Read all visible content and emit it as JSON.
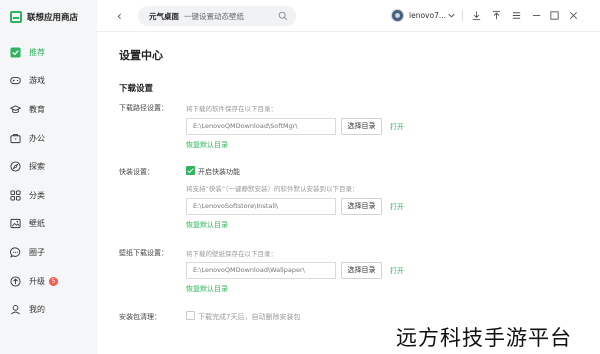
{
  "app": {
    "title": "联想应用商店"
  },
  "sidebar": {
    "items": [
      {
        "label": "推荐",
        "icon": "recommend-icon",
        "active": true
      },
      {
        "label": "游戏",
        "icon": "gamepad-icon"
      },
      {
        "label": "教育",
        "icon": "graduation-cap-icon"
      },
      {
        "label": "办公",
        "icon": "briefcase-icon"
      },
      {
        "label": "探索",
        "icon": "compass-icon"
      },
      {
        "label": "分类",
        "icon": "grid-icon"
      },
      {
        "label": "壁纸",
        "icon": "picture-icon"
      },
      {
        "label": "圈子",
        "icon": "chat-bubble-icon"
      },
      {
        "label": "升级",
        "icon": "upgrade-icon",
        "badge": "5"
      },
      {
        "label": "我的",
        "icon": "user-icon"
      }
    ]
  },
  "topbar": {
    "search_query": "元气桌面",
    "search_hint": "一键设置动态壁纸",
    "user_name": "lenovo7...",
    "accent_color": "#2fb35f"
  },
  "settings": {
    "page_title": "设置中心",
    "section_download": "下载设置",
    "download_path": {
      "label": "下载路径设置：",
      "hint": "将下载的软件保存在以下目录：",
      "value": "E:\\LenovoQMDownload\\SoftMgr\\",
      "choose_label": "选择目录",
      "open_label": "打开",
      "restore_label": "恢复默认目录"
    },
    "quick_install": {
      "label": "快装设置：",
      "checkbox_label": "开启快装功能",
      "hint": "将支持“快装”（一键静默安装）的软件默认安装到以下目录：",
      "value": "E:\\LenovoSoftstore\\Install\\",
      "choose_label": "选择目录",
      "open_label": "打开",
      "restore_label": "恢复默认目录"
    },
    "wallpaper_path": {
      "label": "壁纸下载设置：",
      "hint": "将下载的壁纸保存在以下目录：",
      "value": "E:\\LenovoQMDownload\\Wallpaper\\",
      "choose_label": "选择目录",
      "open_label": "打开",
      "restore_label": "恢复默认目录"
    },
    "cleanup": {
      "label": "安装包清理：",
      "checkbox_label": "下载完成7天后，自动删除安装包"
    }
  },
  "watermark": "远方科技手游平台"
}
